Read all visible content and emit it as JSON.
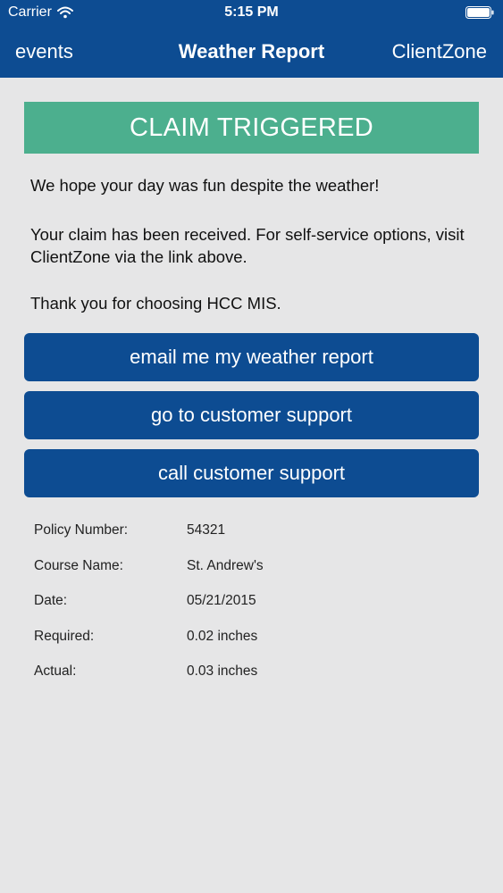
{
  "status_bar": {
    "carrier": "Carrier",
    "time": "5:15 PM"
  },
  "nav": {
    "left_label": "events",
    "title": "Weather Report",
    "right_label": "ClientZone"
  },
  "banner": {
    "text": "CLAIM TRIGGERED",
    "color": "#4caf8e"
  },
  "messages": [
    "We hope your day was fun despite the weather!",
    "Your claim has been received. For self-service options, visit ClientZone via the link above.",
    "Thank you for choosing HCC MIS."
  ],
  "buttons": [
    "email me my weather report",
    "go to customer support",
    "call customer support"
  ],
  "details": [
    {
      "label": "Policy Number:",
      "value": "54321"
    },
    {
      "label": "Course Name:",
      "value": "St. Andrew's"
    },
    {
      "label": "Date:",
      "value": "05/21/2015"
    },
    {
      "label": "Required:",
      "value": "0.02 inches"
    },
    {
      "label": "Actual:",
      "value": "0.03 inches"
    }
  ],
  "colors": {
    "primary": "#0d4c92",
    "background": "#e6e6e7"
  },
  "icons": {
    "wifi": "wifi-icon",
    "battery": "battery-icon"
  }
}
